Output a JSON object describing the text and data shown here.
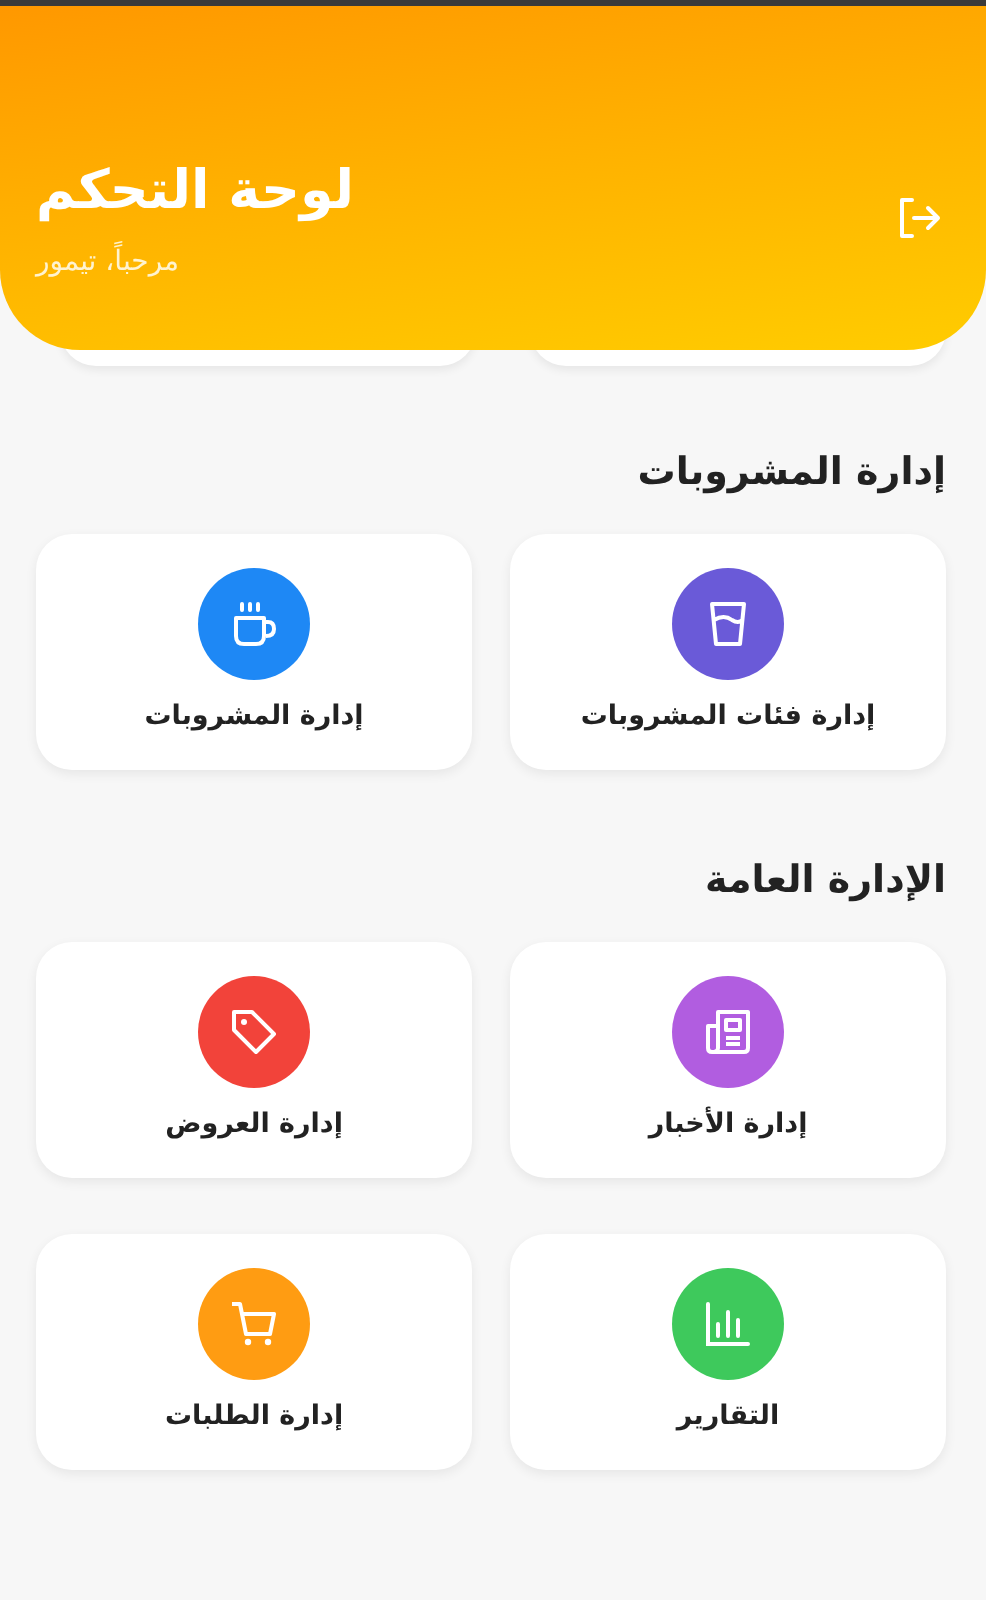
{
  "header": {
    "title": "لوحة التحكم",
    "greeting": "مرحباً، تيمور"
  },
  "sections": [
    {
      "title": "إدارة المشروبات",
      "items": [
        {
          "label": "إدارة فئات المشروبات",
          "kind": "glass",
          "color": "#6a5ad8"
        },
        {
          "label": "إدارة المشروبات",
          "kind": "cup",
          "color": "#1e88f5"
        }
      ]
    },
    {
      "title": "الإدارة العامة",
      "items": [
        {
          "label": "إدارة الأخبار",
          "kind": "news",
          "color": "#b15de0"
        },
        {
          "label": "إدارة العروض",
          "kind": "tag",
          "color": "#f2433a"
        },
        {
          "label": "التقارير",
          "kind": "chart",
          "color": "#3ec95c"
        },
        {
          "label": "إدارة الطلبات",
          "kind": "cart",
          "color": "#ff9c12"
        }
      ]
    }
  ]
}
